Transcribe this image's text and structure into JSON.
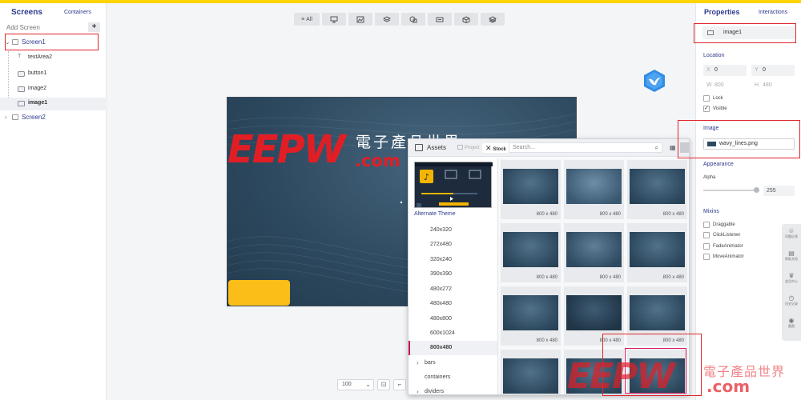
{
  "left_panel": {
    "tab_screens": "Screens",
    "tab_containers": "Containers",
    "add_screen": "Add Screen",
    "add_icon": "+",
    "tree": [
      {
        "label": "Screen1",
        "kind": "screen",
        "expanded": true
      },
      {
        "label": "textArea2",
        "kind": "text"
      },
      {
        "label": "button1",
        "kind": "button"
      },
      {
        "label": "image2",
        "kind": "image"
      },
      {
        "label": "image1",
        "kind": "image",
        "selected": true
      },
      {
        "label": "Screen2",
        "kind": "screen",
        "expanded": false
      }
    ]
  },
  "toolbar": {
    "all_label": "All",
    "icons": [
      "widgets-icon",
      "image-icon",
      "layers-icon",
      "shapes-icon",
      "textfield-icon",
      "box-3d-icon",
      "stack-icon"
    ]
  },
  "canvas": {
    "logo_text": "EEPW",
    "logo_domain": ".com",
    "logo_chinese": "電子產品世界",
    "accent_button_color": "#fbbd18",
    "brand_red": "#e21e25"
  },
  "zoom": {
    "value": "100",
    "dropdown_icon": "⌄",
    "fit_icon": "⊡"
  },
  "assets": {
    "title": "Assets",
    "tab_project": "Project",
    "tab_stock": "Stock",
    "search_placeholder": "Search...",
    "theme_label": "Alternate Theme",
    "folders": [
      {
        "label": "240x320"
      },
      {
        "label": "272x480"
      },
      {
        "label": "320x240"
      },
      {
        "label": "390x390"
      },
      {
        "label": "480x272"
      },
      {
        "label": "480x480"
      },
      {
        "label": "480x800"
      },
      {
        "label": "600x1024"
      },
      {
        "label": "800x480",
        "selected": true
      },
      {
        "label": "bars",
        "sub": true
      },
      {
        "label": "containers",
        "sub": true
      },
      {
        "label": "dividers",
        "sub": true
      }
    ],
    "thumbs": [
      {
        "size": "800 x 480"
      },
      {
        "size": "800 x 480"
      },
      {
        "size": "800 x 480"
      },
      {
        "size": "800 x 480"
      },
      {
        "size": "800 x 480"
      },
      {
        "size": "800 x 480"
      },
      {
        "size": "800 x 480"
      },
      {
        "size": "800 x 480"
      },
      {
        "size": "800 x 480"
      },
      {
        "size": ""
      },
      {
        "size": ""
      },
      {
        "size": ""
      }
    ]
  },
  "properties": {
    "tab_properties": "Properties",
    "tab_interactions": "Interactions",
    "name": "image1",
    "location_title": "Location",
    "x_label": "X",
    "x_value": "0",
    "y_label": "Y",
    "y_value": "0",
    "w_label": "W",
    "w_value": "800",
    "h_label": "H",
    "h_value": "480",
    "lock_label": "Lock",
    "visible_label": "Visible",
    "visible_checked": "✓",
    "image_title": "Image",
    "image_file": "wavy_lines.png",
    "appearance_title": "Appearance",
    "alpha_label": "Alpha",
    "alpha_value": "255",
    "alpha_fraction": 1.0,
    "mixins_title": "Mixins",
    "mixins": [
      "Draggable",
      "ClickListener",
      "FadeAnimator",
      "MoveAnimator"
    ]
  },
  "side_tools": [
    "问题反馈",
    "帮助文档",
    "会员中心",
    "历史记录",
    "截图"
  ],
  "watermark": {
    "text": "EEPW",
    "chinese": "電子產品世界",
    "domain": ".com"
  }
}
